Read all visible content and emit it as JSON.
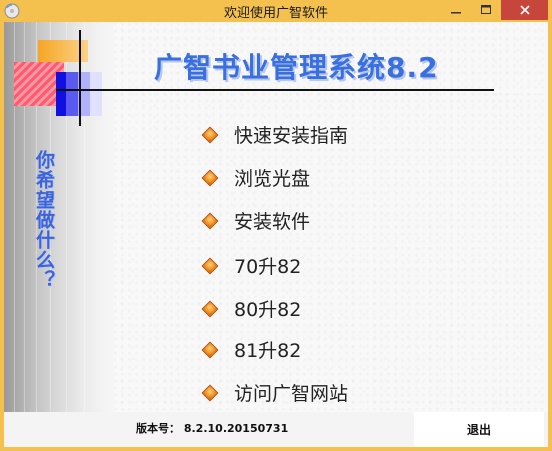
{
  "window": {
    "title": "欢迎使用广智软件",
    "minimize_icon": "minimize-icon",
    "maximize_icon": "maximize-icon",
    "close_icon": "close-icon",
    "frame_color": "#f4c14f",
    "close_color": "#c7463b"
  },
  "sidebar": {
    "vertical_text": "你希望做什么？",
    "text_color": "#3c63d8"
  },
  "header": {
    "app_title": "广智书业管理系统8.2",
    "title_color": "#3a6fe0"
  },
  "menu": {
    "items": [
      {
        "label": "快速安装指南",
        "icon": "orange-diamond-bullet-icon"
      },
      {
        "label": "浏览光盘",
        "icon": "orange-diamond-bullet-icon"
      },
      {
        "label": "安装软件",
        "icon": "orange-diamond-bullet-icon"
      },
      {
        "label": "70升82",
        "icon": "orange-diamond-bullet-icon"
      },
      {
        "label": "80升82",
        "icon": "orange-diamond-bullet-icon"
      },
      {
        "label": "81升82",
        "icon": "orange-diamond-bullet-icon"
      },
      {
        "label": "访问广智网站",
        "icon": "orange-diamond-bullet-icon"
      }
    ]
  },
  "footer": {
    "version_label": "版本号：",
    "version_value": "8.2.10.20150731",
    "exit_label": "退出"
  }
}
